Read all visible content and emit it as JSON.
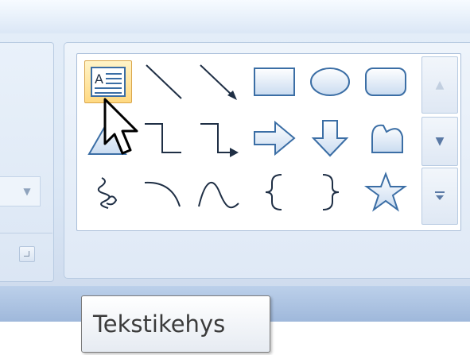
{
  "ribbon": {
    "shapes_gallery": {
      "rows": [
        [
          {
            "name": "text-box-icon",
            "selected": true
          },
          {
            "name": "line-icon"
          },
          {
            "name": "arrow-line-icon"
          },
          {
            "name": "rectangle-icon"
          },
          {
            "name": "oval-icon"
          },
          {
            "name": "rounded-rectangle-icon"
          }
        ],
        [
          {
            "name": "triangle-icon"
          },
          {
            "name": "elbow-connector-icon"
          },
          {
            "name": "elbow-arrow-connector-icon"
          },
          {
            "name": "right-arrow-icon"
          },
          {
            "name": "down-arrow-icon"
          },
          {
            "name": "callout-icon"
          }
        ],
        [
          {
            "name": "freeform-scribble-icon"
          },
          {
            "name": "arc-icon"
          },
          {
            "name": "curve-icon"
          },
          {
            "name": "left-brace-icon"
          },
          {
            "name": "right-brace-icon"
          },
          {
            "name": "star-icon"
          }
        ]
      ],
      "scroll": [
        "scroll-up",
        "scroll-down",
        "more"
      ]
    }
  },
  "tooltip": {
    "text": "Tekstikehys"
  },
  "colors": {
    "selected_bg": "#ffd982",
    "gallery_border": "#a9bed9",
    "icon_blue": "#3b6ea5",
    "icon_dark": "#1f2f45"
  }
}
